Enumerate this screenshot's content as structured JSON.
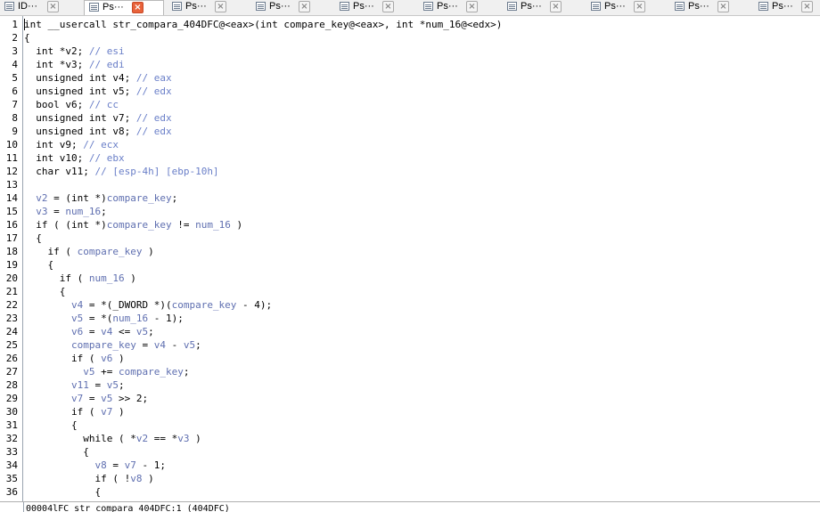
{
  "tabs": [
    {
      "label": "ID···",
      "active": false
    },
    {
      "label": "Ps···",
      "active": true
    },
    {
      "label": "Ps···",
      "active": false
    },
    {
      "label": "Ps···",
      "active": false
    },
    {
      "label": "Ps···",
      "active": false
    },
    {
      "label": "Ps···",
      "active": false
    },
    {
      "label": "Ps···",
      "active": false
    },
    {
      "label": "Ps···",
      "active": false
    },
    {
      "label": "Ps···",
      "active": false
    },
    {
      "label": "Ps···",
      "active": false
    }
  ],
  "lines": [
    {
      "n": "1",
      "t": [
        [
          "int __usercall str_compara_404DFC@<eax>(int compare_key@<eax>, int *num_16@<edx>)",
          ""
        ]
      ]
    },
    {
      "n": "2",
      "t": [
        [
          "{",
          ""
        ]
      ]
    },
    {
      "n": "3",
      "t": [
        [
          "  int *v2; ",
          ""
        ],
        [
          "// esi",
          "c"
        ]
      ]
    },
    {
      "n": "4",
      "t": [
        [
          "  int *v3; ",
          ""
        ],
        [
          "// edi",
          "c"
        ]
      ]
    },
    {
      "n": "5",
      "t": [
        [
          "  unsigned int v4; ",
          ""
        ],
        [
          "// eax",
          "c"
        ]
      ]
    },
    {
      "n": "6",
      "t": [
        [
          "  unsigned int v5; ",
          ""
        ],
        [
          "// edx",
          "c"
        ]
      ]
    },
    {
      "n": "7",
      "t": [
        [
          "  bool v6; ",
          ""
        ],
        [
          "// cc",
          "c"
        ]
      ]
    },
    {
      "n": "8",
      "t": [
        [
          "  unsigned int v7; ",
          ""
        ],
        [
          "// edx",
          "c"
        ]
      ]
    },
    {
      "n": "9",
      "t": [
        [
          "  unsigned int v8; ",
          ""
        ],
        [
          "// edx",
          "c"
        ]
      ]
    },
    {
      "n": "10",
      "t": [
        [
          "  int v9; ",
          ""
        ],
        [
          "// ecx",
          "c"
        ]
      ]
    },
    {
      "n": "11",
      "t": [
        [
          "  int v10; ",
          ""
        ],
        [
          "// ebx",
          "c"
        ]
      ]
    },
    {
      "n": "12",
      "t": [
        [
          "  char v11; ",
          ""
        ],
        [
          "// [esp-4h] [ebp-10h]",
          "c"
        ]
      ]
    },
    {
      "n": "13",
      "t": [
        [
          "",
          ""
        ]
      ]
    },
    {
      "n": "14",
      "t": [
        [
          "  ",
          ""
        ],
        [
          "v2",
          "v"
        ],
        [
          " = (int *)",
          ""
        ],
        [
          "compare_key",
          "v"
        ],
        [
          ";",
          ""
        ]
      ]
    },
    {
      "n": "15",
      "t": [
        [
          "  ",
          ""
        ],
        [
          "v3",
          "v"
        ],
        [
          " = ",
          ""
        ],
        [
          "num_16",
          "v"
        ],
        [
          ";",
          ""
        ]
      ]
    },
    {
      "n": "16",
      "t": [
        [
          "  if ( (int *)",
          ""
        ],
        [
          "compare_key",
          "v"
        ],
        [
          " != ",
          ""
        ],
        [
          "num_16",
          "v"
        ],
        [
          " )",
          ""
        ]
      ]
    },
    {
      "n": "17",
      "t": [
        [
          "  {",
          ""
        ]
      ]
    },
    {
      "n": "18",
      "t": [
        [
          "    if ( ",
          ""
        ],
        [
          "compare_key",
          "v"
        ],
        [
          " )",
          ""
        ]
      ]
    },
    {
      "n": "19",
      "t": [
        [
          "    {",
          ""
        ]
      ]
    },
    {
      "n": "20",
      "t": [
        [
          "      if ( ",
          ""
        ],
        [
          "num_16",
          "v"
        ],
        [
          " )",
          ""
        ]
      ]
    },
    {
      "n": "21",
      "t": [
        [
          "      {",
          ""
        ]
      ]
    },
    {
      "n": "22",
      "t": [
        [
          "        ",
          ""
        ],
        [
          "v4",
          "v"
        ],
        [
          " = *(_DWORD *)(",
          ""
        ],
        [
          "compare_key",
          "v"
        ],
        [
          " - 4);",
          ""
        ]
      ]
    },
    {
      "n": "23",
      "t": [
        [
          "        ",
          ""
        ],
        [
          "v5",
          "v"
        ],
        [
          " = *(",
          ""
        ],
        [
          "num_16",
          "v"
        ],
        [
          " - 1);",
          ""
        ]
      ]
    },
    {
      "n": "24",
      "t": [
        [
          "        ",
          ""
        ],
        [
          "v6",
          "v"
        ],
        [
          " = ",
          ""
        ],
        [
          "v4",
          "v"
        ],
        [
          " <= ",
          ""
        ],
        [
          "v5",
          "v"
        ],
        [
          ";",
          ""
        ]
      ]
    },
    {
      "n": "25",
      "t": [
        [
          "        ",
          ""
        ],
        [
          "compare_key",
          "v"
        ],
        [
          " = ",
          ""
        ],
        [
          "v4",
          "v"
        ],
        [
          " - ",
          ""
        ],
        [
          "v5",
          "v"
        ],
        [
          ";",
          ""
        ]
      ]
    },
    {
      "n": "26",
      "t": [
        [
          "        if ( ",
          ""
        ],
        [
          "v6",
          "v"
        ],
        [
          " )",
          ""
        ]
      ]
    },
    {
      "n": "27",
      "t": [
        [
          "          ",
          ""
        ],
        [
          "v5",
          "v"
        ],
        [
          " += ",
          ""
        ],
        [
          "compare_key",
          "v"
        ],
        [
          ";",
          ""
        ]
      ]
    },
    {
      "n": "28",
      "t": [
        [
          "        ",
          ""
        ],
        [
          "v11",
          "v"
        ],
        [
          " = ",
          ""
        ],
        [
          "v5",
          "v"
        ],
        [
          ";",
          ""
        ]
      ]
    },
    {
      "n": "29",
      "t": [
        [
          "        ",
          ""
        ],
        [
          "v7",
          "v"
        ],
        [
          " = ",
          ""
        ],
        [
          "v5",
          "v"
        ],
        [
          " >> 2;",
          ""
        ]
      ]
    },
    {
      "n": "30",
      "t": [
        [
          "        if ( ",
          ""
        ],
        [
          "v7",
          "v"
        ],
        [
          " )",
          ""
        ]
      ]
    },
    {
      "n": "31",
      "t": [
        [
          "        {",
          ""
        ]
      ]
    },
    {
      "n": "32",
      "t": [
        [
          "          while ( *",
          ""
        ],
        [
          "v2",
          "v"
        ],
        [
          " == *",
          ""
        ],
        [
          "v3",
          "v"
        ],
        [
          " )",
          ""
        ]
      ]
    },
    {
      "n": "33",
      "t": [
        [
          "          {",
          ""
        ]
      ]
    },
    {
      "n": "34",
      "t": [
        [
          "            ",
          ""
        ],
        [
          "v8",
          "v"
        ],
        [
          " = ",
          ""
        ],
        [
          "v7",
          "v"
        ],
        [
          " - 1;",
          ""
        ]
      ]
    },
    {
      "n": "35",
      "t": [
        [
          "            if ( !",
          ""
        ],
        [
          "v8",
          "v"
        ],
        [
          " )",
          ""
        ]
      ]
    },
    {
      "n": "36",
      "t": [
        [
          "            {",
          ""
        ]
      ]
    }
  ],
  "status": "00004lFC str_compara_404DFC:1 (404DFC)"
}
